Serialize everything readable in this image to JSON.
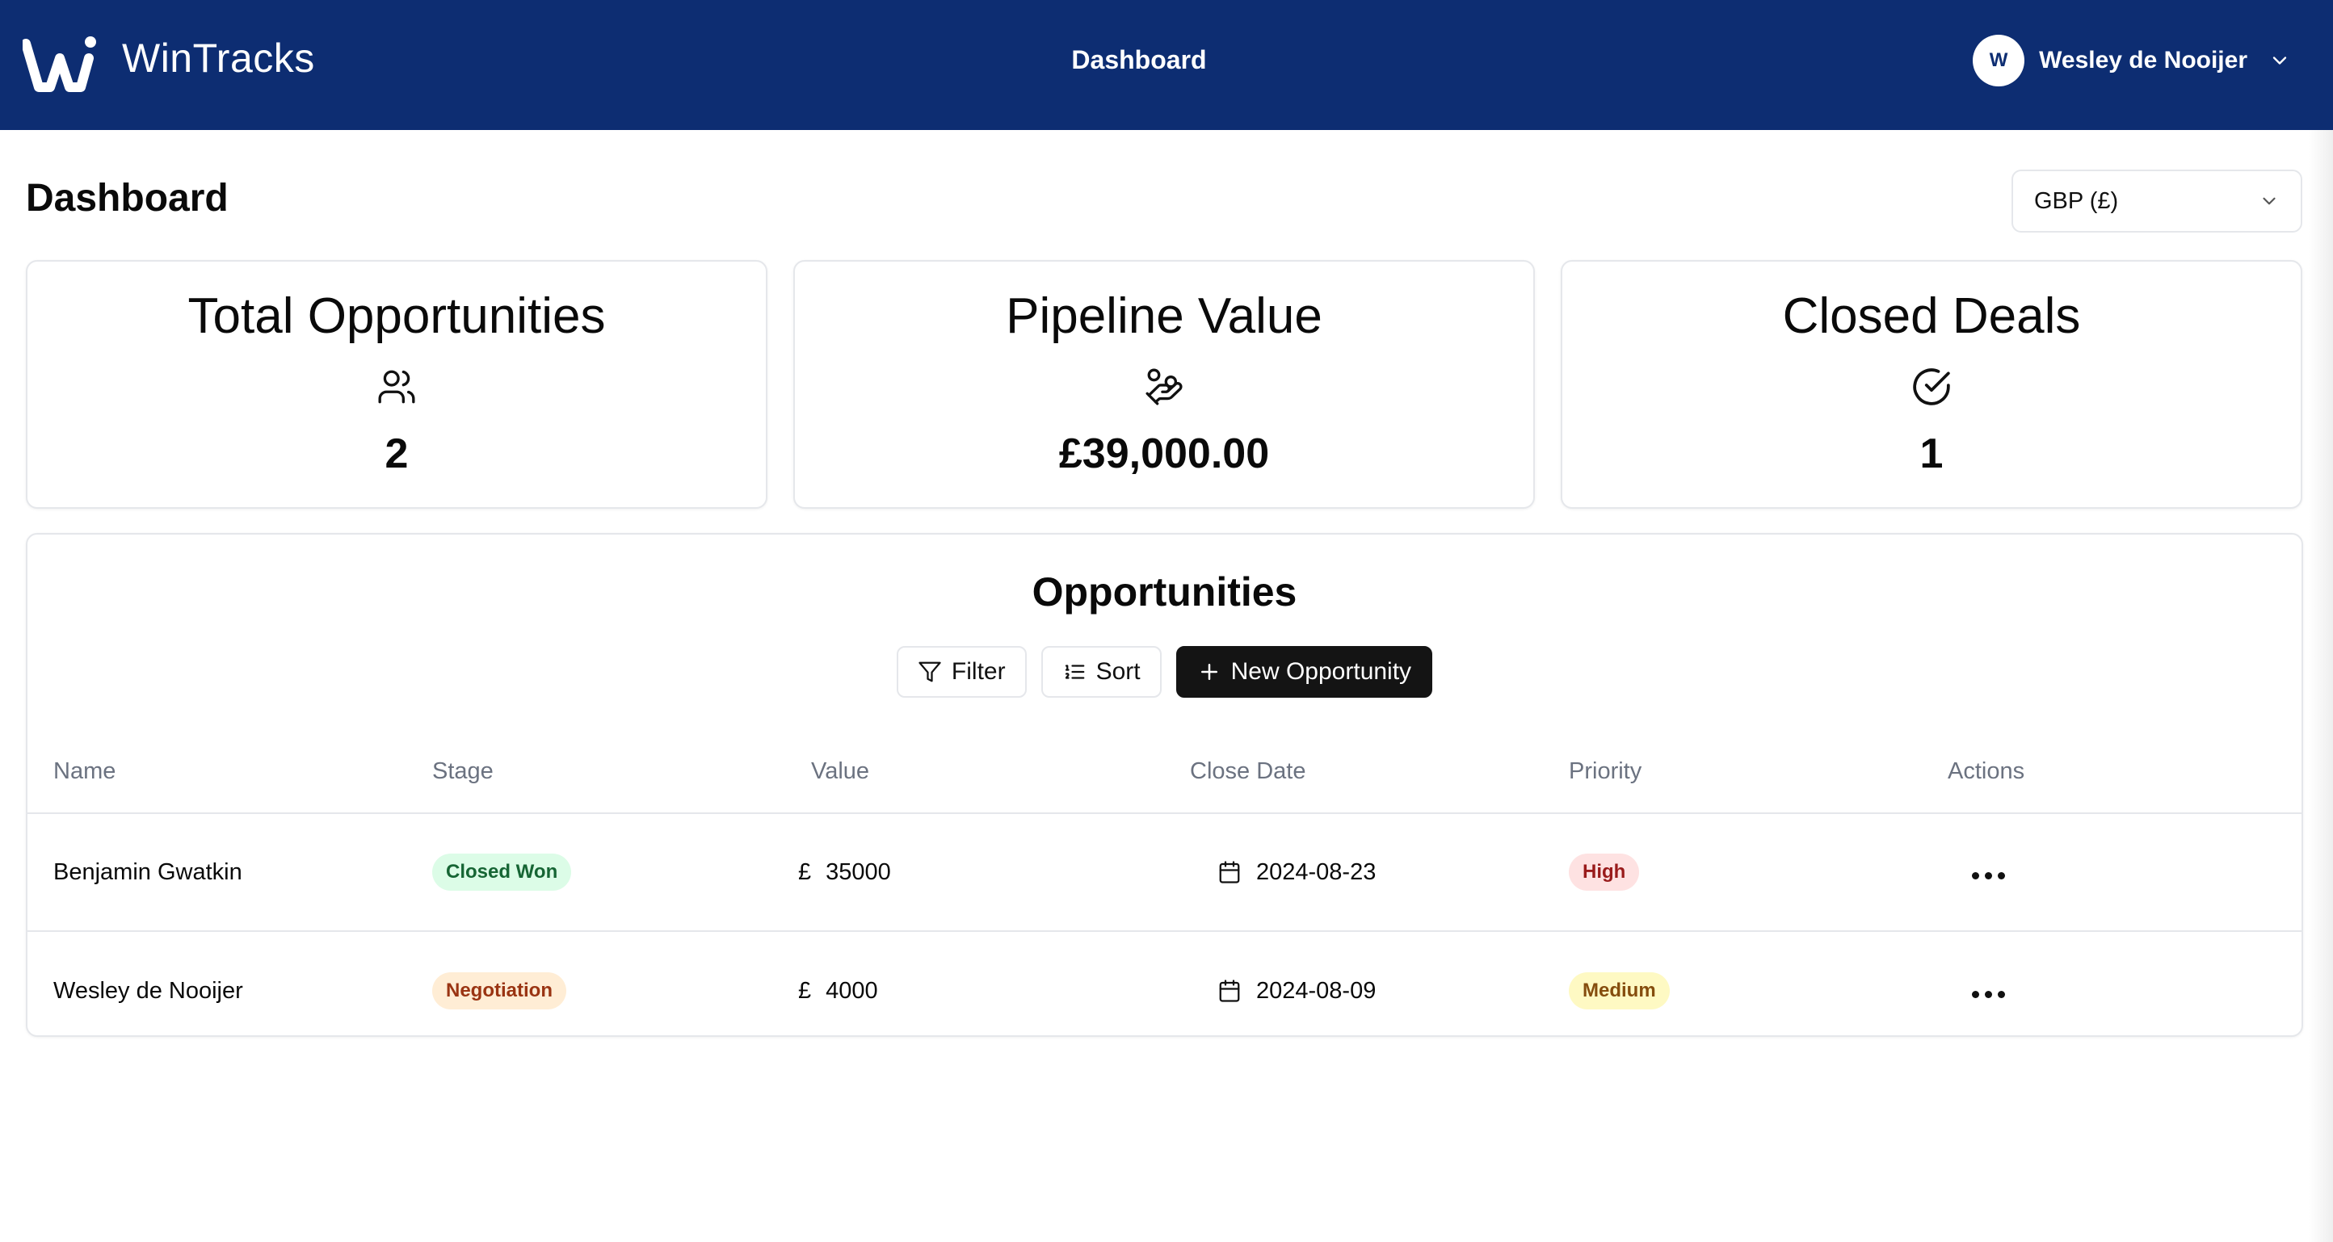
{
  "header": {
    "brand": "WinTracks",
    "center_title": "Dashboard",
    "user": {
      "initial": "W",
      "name": "Wesley de Nooijer"
    }
  },
  "page": {
    "title": "Dashboard",
    "currency": {
      "selected": "GBP (£)"
    }
  },
  "stats": [
    {
      "title": "Total Opportunities",
      "icon": "users-icon",
      "value": "2"
    },
    {
      "title": "Pipeline Value",
      "icon": "hand-coins-icon",
      "value": "£39,000.00"
    },
    {
      "title": "Closed Deals",
      "icon": "check-circle-icon",
      "value": "1"
    }
  ],
  "opportunities": {
    "title": "Opportunities",
    "buttons": {
      "filter": "Filter",
      "sort": "Sort",
      "new": "New Opportunity"
    },
    "columns": [
      "Name",
      "Stage",
      "Value",
      "Close Date",
      "Priority",
      "Actions"
    ],
    "rows": [
      {
        "name": "Benjamin Gwatkin",
        "stage": "Closed Won",
        "currency": "£",
        "value": "35000",
        "close_date": "2024-08-23",
        "priority": "High"
      },
      {
        "name": "Wesley de Nooijer",
        "stage": "Negotiation",
        "currency": "£",
        "value": "4000",
        "close_date": "2024-08-09",
        "priority": "Medium"
      }
    ]
  },
  "colors": {
    "header_bg": "#0d2d72",
    "stage_closed_won": "#dcfce7",
    "stage_negotiation": "#ffedd5",
    "priority_high": "#fee2e2",
    "priority_medium": "#fef9c3",
    "primary_button": "#141414"
  }
}
